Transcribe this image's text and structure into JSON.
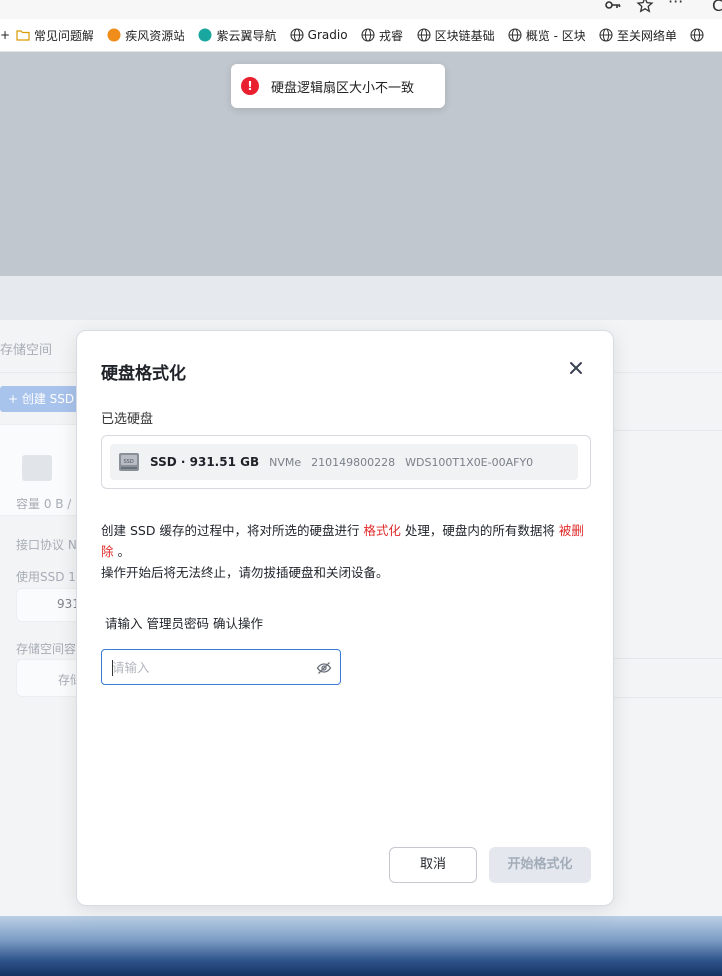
{
  "browser": {
    "bookmarks": [
      {
        "label": "常见问题解",
        "icon": "folder-icon"
      },
      {
        "label": "疾风资源站",
        "icon": "site-icon-orange"
      },
      {
        "label": "紫云翼导航",
        "icon": "site-icon-teal"
      },
      {
        "label": "Gradio",
        "icon": "globe-icon"
      },
      {
        "label": "戎睿",
        "icon": "globe-icon"
      },
      {
        "label": "区块链基础",
        "icon": "globe-icon"
      },
      {
        "label": "概览 - 区块",
        "icon": "globe-icon"
      },
      {
        "label": "至关网络单",
        "icon": "globe-icon"
      }
    ]
  },
  "toast": {
    "message": "硬盘逻辑扇区大小不一致",
    "icon": "error-icon",
    "color": "#e8202f"
  },
  "background": {
    "storage_space": "存储空间",
    "create_ssd": "+ 创建 SSD",
    "capacity": "容量 0 B /",
    "interface": "接口协议 N",
    "use_ssd": "使用SSD 1",
    "ssd_size": "931",
    "storage_cap": "存储空间容",
    "storage_short": "存储"
  },
  "dialog": {
    "title": "硬盘格式化",
    "selected_label": "已选硬盘",
    "disk": {
      "name": "SSD · 931.51 GB",
      "interface": "NVMe",
      "serial": "210149800228",
      "model": "WDS100T1X0E-00AFY0"
    },
    "warning": {
      "part1": "创建 SSD 缓存的过程中，将对所选的硬盘进行 ",
      "format_word": "格式化",
      "part2": " 处理，硬盘内的所有数据将 ",
      "delete_word": "被删除",
      "part3": " 。",
      "line2": "操作开始后将无法终止，请勿拔插硬盘和关闭设备。"
    },
    "password_label": "请输入 管理员密码 确认操作",
    "password_placeholder": "请输入",
    "cancel_label": "取消",
    "start_label": "开始格式化"
  },
  "colors": {
    "danger": "#e02b2b",
    "accent": "#3a7bd5"
  }
}
